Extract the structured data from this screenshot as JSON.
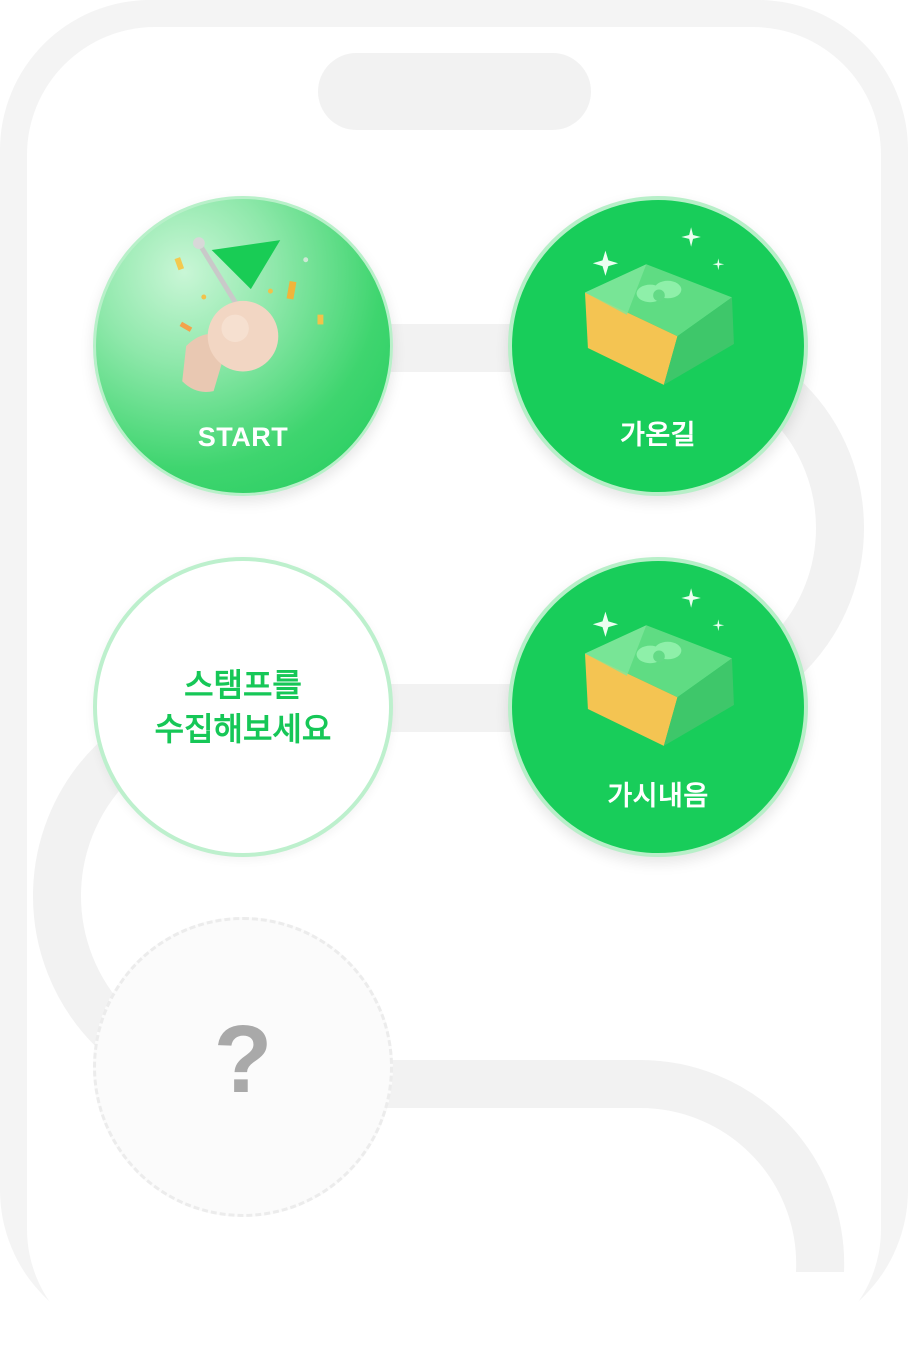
{
  "stamps": {
    "start": {
      "label": "START",
      "icon": "megaphone-flag-icon"
    },
    "stamp2": {
      "label": "가온길",
      "icon": "gift-box-icon"
    },
    "collect": {
      "line1": "스탬프를",
      "line2": "수집해보세요"
    },
    "stamp3": {
      "label": "가시내음",
      "icon": "gift-box-icon"
    },
    "locked": {
      "symbol": "?"
    }
  },
  "colors": {
    "accent": "#18cd5a",
    "accent_border": "#b7efc8",
    "path": "#f2f2f2",
    "locked_text": "#a9a9a9"
  }
}
